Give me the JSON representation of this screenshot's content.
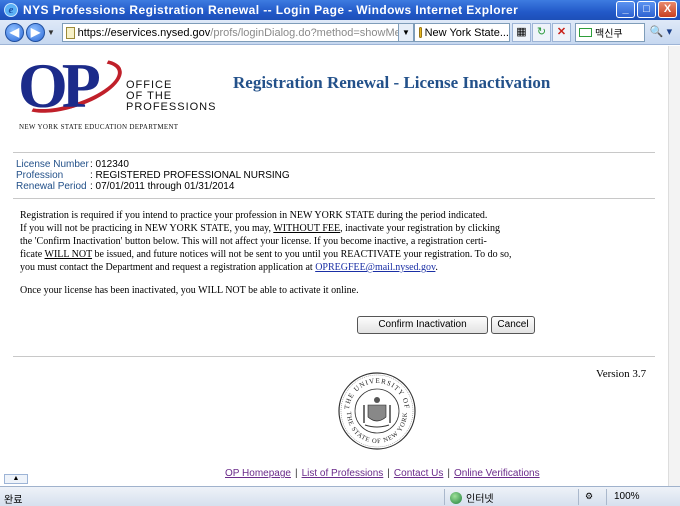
{
  "window": {
    "title": "NYS Professions Registration Renewal -- Login Page - Windows Internet Explorer",
    "buttons": {
      "minimize": "_",
      "maximize": "□",
      "close": "X"
    }
  },
  "address_bar": {
    "url_prefix": "https://",
    "url_host": "eservices.nysed.gov",
    "url_path": "/profs/loginDialog.do?method=showMenu",
    "certificate_label": "New York State...",
    "search_text": "맥신쿠",
    "search_go": "🔍 ▾"
  },
  "logo": {
    "letters": "OP",
    "line1": "OFFICE",
    "line2": "OF THE",
    "line3": "PROFESSIONS",
    "department": "NEW YORK STATE EDUCATION DEPARTMENT"
  },
  "page": {
    "title": "Registration Renewal - License Inactivation",
    "license_number_label": "License Number",
    "license_number": ": 012340",
    "profession_label": "Profession",
    "profession": ": REGISTERED PROFESSIONAL NURSING",
    "renewal_period_label": "Renewal Period",
    "renewal_period": ": 07/01/2011 through 01/31/2014",
    "para_l1": "Registration is required if you intend to practice your profession in NEW YORK STATE during the period indicated.",
    "para_l2a": "If you will not be practicing in NEW YORK STATE, you may, ",
    "para_l2u": "WITHOUT FEE",
    "para_l2b": ", inactivate your registration by clicking",
    "para_l3": "the 'Confirm Inactivation' button below. This will not affect your license. If you become inactive, a registration certi-",
    "para_l4a": "ficate ",
    "para_l4u": "WILL NOT",
    "para_l4b": " be issued, and future notices will not be sent to you until you REACTIVATE your registration. To do so,",
    "para_l5a": "you must contact the Department and request a registration application at  ",
    "email": "OPREGFEE@mail.nysed.gov",
    "para_l5b": ".",
    "para2": "Once your license has been inactivated, you WILL NOT be able to activate it online.",
    "confirm_button": "Confirm Inactivation",
    "cancel_button": "Cancel",
    "version": "Version 3.7"
  },
  "seal": {
    "top_text": "THE UNIVERSITY OF",
    "bottom_text": "THE STATE OF NEW YORK"
  },
  "footer": {
    "links": [
      "OP Homepage",
      "List of Professions",
      "Contact Us",
      "Online Verifications"
    ],
    "separator": "|"
  },
  "status_bar": {
    "status": "완료",
    "zone": "인터넷",
    "zoom": "100%"
  }
}
